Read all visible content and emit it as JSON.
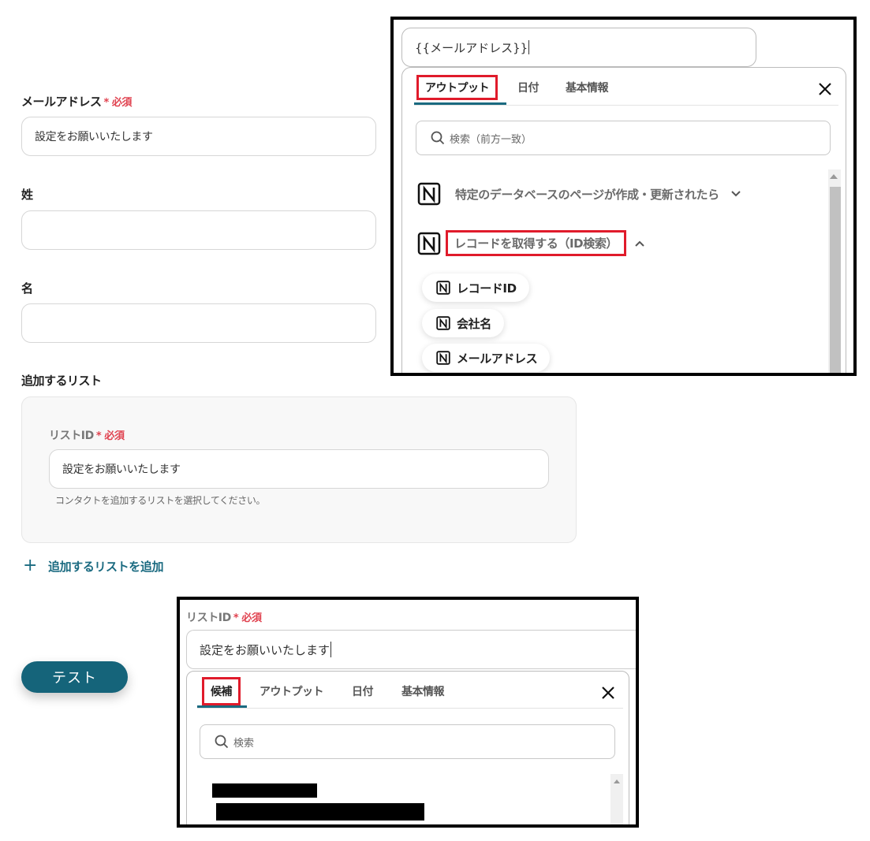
{
  "form": {
    "email_label": "メールアドレス",
    "required_mark": "* 必須",
    "email_value": "設定をお願いいたします",
    "last_name_label": "姓",
    "last_name_value": "",
    "first_name_label": "名",
    "first_name_value": "",
    "list_section_label": "追加するリスト",
    "list_id_label": "リストID",
    "list_id_value": "設定をお願いいたします",
    "list_id_hint": "コンタクトを追加するリストを選択してください。",
    "add_list_label": "追加するリストを追加",
    "test_button": "テスト"
  },
  "popup1": {
    "variable_value": "{{メールアドレス}}",
    "tabs": [
      "アウトプット",
      "日付",
      "基本情報"
    ],
    "active_tab": "アウトプット",
    "search_placeholder": "検索（前方一致）",
    "sections": [
      {
        "title": "特定のデータベースのページが作成・更新されたら",
        "expanded": false
      },
      {
        "title": "レコードを取得する（ID検索）",
        "expanded": true
      }
    ],
    "items": [
      "レコードID",
      "会社名",
      "メールアドレス"
    ]
  },
  "popup2": {
    "list_id_label": "リストID",
    "required_mark": "* 必須",
    "list_id_value": "設定をお願いいたします",
    "tabs": [
      "候補",
      "アウトプット",
      "日付",
      "基本情報"
    ],
    "active_tab": "候補",
    "search_placeholder": "検索"
  },
  "colors": {
    "accent": "#15647a",
    "required": "#e0424f",
    "highlight_box": "#e01b2b"
  }
}
